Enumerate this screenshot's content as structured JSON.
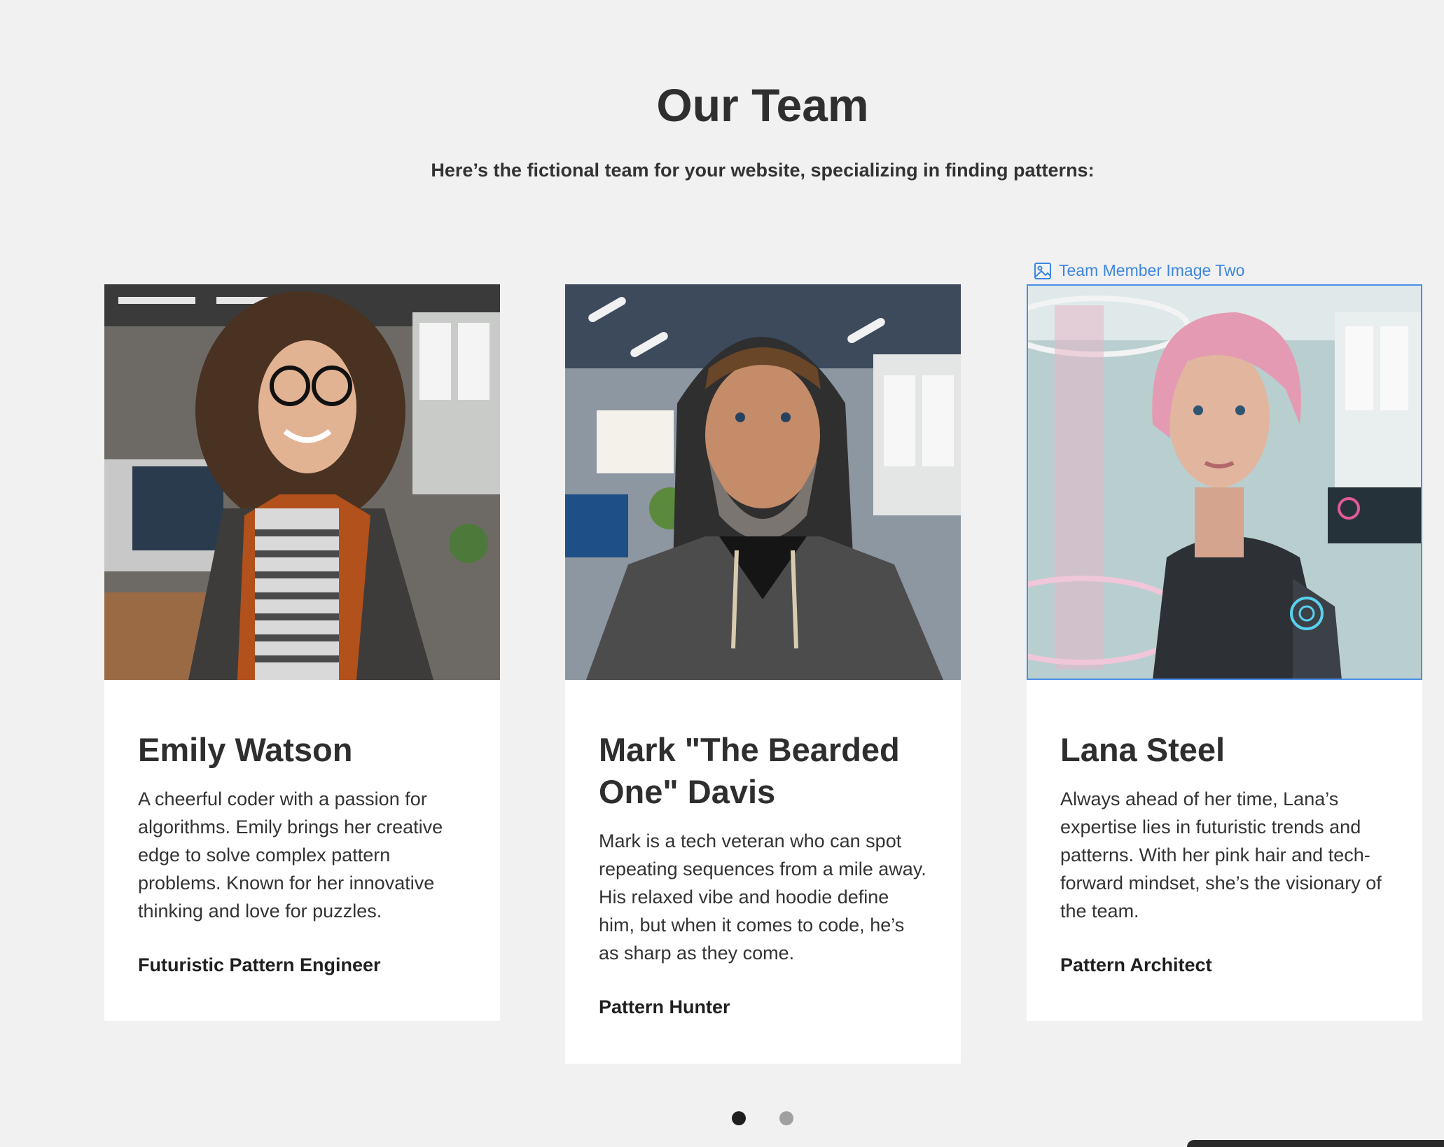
{
  "section": {
    "title": "Our Team",
    "subtitle": "Here’s the fictional team for your website, specializing in finding patterns:"
  },
  "selected_image_label": "Team Member Image Two",
  "members": [
    {
      "name": "Emily Watson",
      "description": "A cheerful coder with a passion for algorithms. Emily brings her creative edge to solve complex pattern problems. Known for her innovative thinking and love for puzzles.",
      "role": "Futuristic Pattern Engineer"
    },
    {
      "name": "Mark \"The Bearded One\" Davis",
      "description": "Mark is a tech veteran who can spot repeating sequences from a mile away. His relaxed vibe and hoodie define him, but when it comes to code, he’s as sharp as they come.",
      "role": "Pattern Hunter"
    },
    {
      "name": "Lana Steel",
      "description": "Always ahead of her time, Lana’s expertise lies in futuristic trends and patterns. With her pink hair and tech-forward mindset, she’s the visionary of the team.",
      "role": "Pattern Architect"
    }
  ],
  "carousel": {
    "active_page": 1,
    "page_count": 2
  },
  "colors": {
    "background": "#f1f1f1",
    "selection": "#4a8fe7",
    "dot_active": "#1e1e1e",
    "dot_inactive": "#a0a0a0"
  }
}
